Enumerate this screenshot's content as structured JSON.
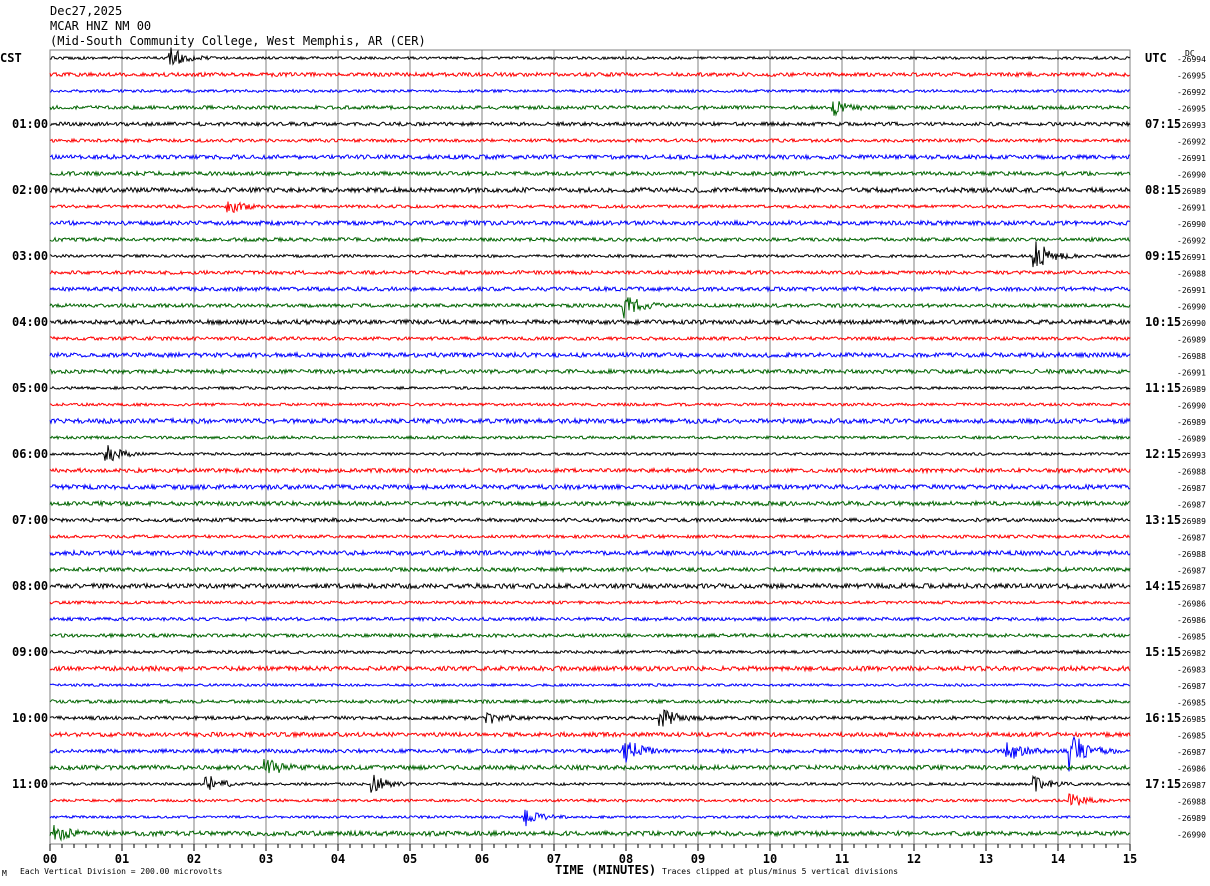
{
  "header": {
    "date": "Dec27,2025",
    "station": "MCAR HNZ NM 00",
    "location": "(Mid-South Community College, West Memphis, AR (CER)"
  },
  "left_zone": "CST",
  "right_zone": "UTC",
  "dc_label": "DC",
  "footer": {
    "scale": "Each Vertical Division =  200.00 microvolts",
    "xlabel": "TIME (MINUTES)",
    "clip_note": "Traces clipped at plus/minus 5 vertical divisions",
    "corner_mark": "M"
  },
  "chart_data": {
    "type": "line",
    "subtype": "helicorder",
    "xlabel": "TIME (MINUTES)",
    "xlim": [
      0,
      15
    ],
    "x_ticks": [
      "00",
      "01",
      "02",
      "03",
      "04",
      "05",
      "06",
      "07",
      "08",
      "09",
      "10",
      "11",
      "12",
      "13",
      "14",
      "15"
    ],
    "grid": true,
    "trace_colors": [
      "#000000",
      "#ff0000",
      "#0000ff",
      "#006400"
    ],
    "left_labels": [
      "CST",
      "01:00",
      "02:00",
      "03:00",
      "04:00",
      "05:00",
      "06:00",
      "07:00",
      "08:00",
      "09:00",
      "10:00",
      "11:00"
    ],
    "right_labels": [
      "UTC",
      "07:15",
      "08:15",
      "09:15",
      "10:15",
      "11:15",
      "12:15",
      "13:15",
      "14:15",
      "15:15",
      "16:15",
      "17:15"
    ],
    "dc_offsets": [
      -26994,
      -26995,
      -26992,
      -26995,
      -26993,
      -26992,
      -26991,
      -26990,
      -26989,
      -26991,
      -26990,
      -26992,
      -26991,
      -26988,
      -26991,
      -26990,
      -26990,
      -26989,
      -26988,
      -26991,
      -26989,
      -26990,
      -26989,
      -26989,
      -26993,
      -26988,
      -26987,
      -26987,
      -26989,
      -26987,
      -26988,
      -26987,
      -26987,
      -26986,
      -26986,
      -26985,
      -26982,
      -26983,
      -26987,
      -26985,
      -26985,
      -26985,
      -26987,
      -26986,
      -26987,
      -26988,
      -26989,
      -26990
    ],
    "events": [
      {
        "row": 0,
        "minute": 1.7,
        "amplitude": 0.6
      },
      {
        "row": 3,
        "minute": 10.9,
        "amplitude": 0.4
      },
      {
        "row": 9,
        "minute": 2.5,
        "amplitude": 0.4
      },
      {
        "row": 12,
        "minute": 13.7,
        "amplitude": 0.9
      },
      {
        "row": 15,
        "minute": 8.0,
        "amplitude": 0.7
      },
      {
        "row": 24,
        "minute": 0.8,
        "amplitude": 0.5
      },
      {
        "row": 40,
        "minute": 8.5,
        "amplitude": 0.6
      },
      {
        "row": 40,
        "minute": 6.1,
        "amplitude": 0.3
      },
      {
        "row": 42,
        "minute": 8.0,
        "amplitude": 0.8
      },
      {
        "row": 42,
        "minute": 13.3,
        "amplitude": 0.6
      },
      {
        "row": 42,
        "minute": 14.2,
        "amplitude": 1.2
      },
      {
        "row": 43,
        "minute": 3.0,
        "amplitude": 0.6
      },
      {
        "row": 44,
        "minute": 2.2,
        "amplitude": 0.5
      },
      {
        "row": 44,
        "minute": 4.5,
        "amplitude": 0.5
      },
      {
        "row": 44,
        "minute": 13.7,
        "amplitude": 0.4
      },
      {
        "row": 45,
        "minute": 14.2,
        "amplitude": 0.4
      },
      {
        "row": 46,
        "minute": 6.6,
        "amplitude": 0.6
      },
      {
        "row": 47,
        "minute": 0.1,
        "amplitude": 0.4
      }
    ]
  }
}
